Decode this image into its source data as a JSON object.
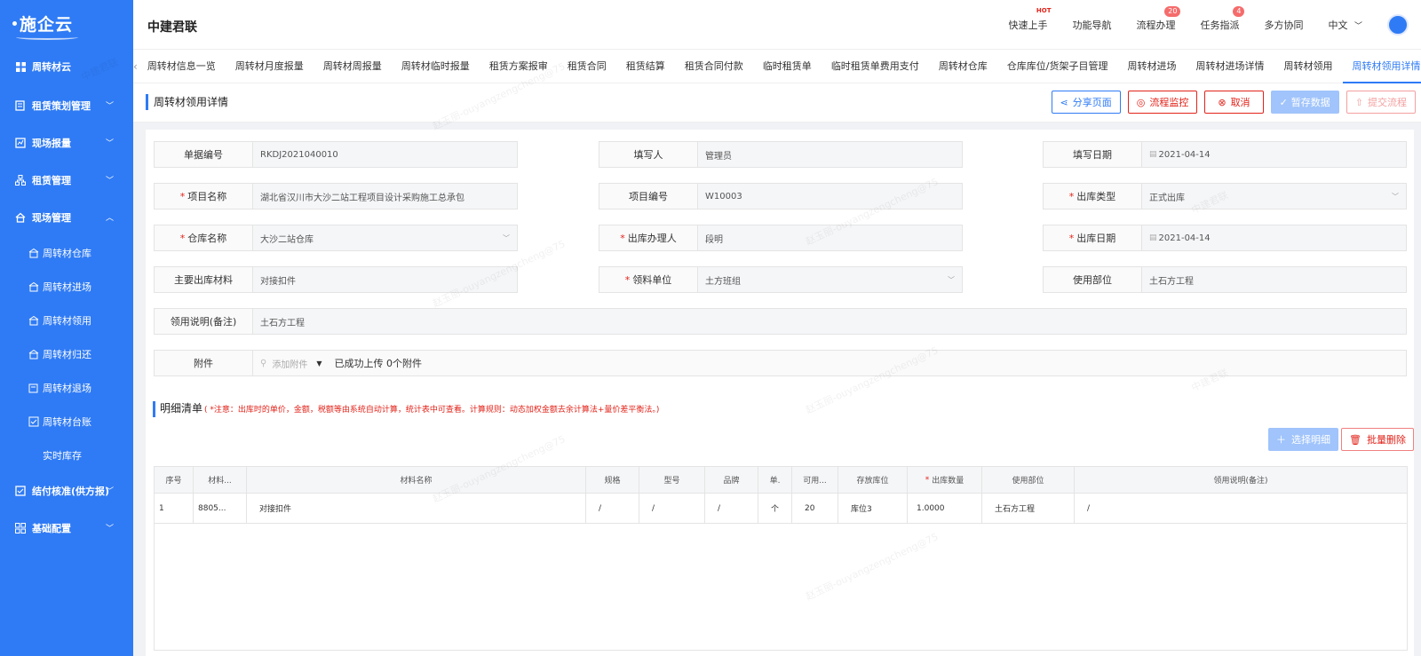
{
  "sidebar": {
    "logo": "施企云",
    "items": [
      {
        "label": "周转材云",
        "icon": "grid-icon"
      },
      {
        "label": "租赁策划管理",
        "icon": "plan-icon"
      },
      {
        "label": "现场报量",
        "icon": "report-icon"
      },
      {
        "label": "租赁管理",
        "icon": "org-icon"
      },
      {
        "label": "现场管理",
        "icon": "home-icon"
      }
    ],
    "sub_items": [
      {
        "label": "周转材仓库"
      },
      {
        "label": "周转材进场"
      },
      {
        "label": "周转材领用"
      },
      {
        "label": "周转材归还"
      },
      {
        "label": "周转材退场"
      },
      {
        "label": "周转材台账"
      },
      {
        "label": "实时库存"
      }
    ],
    "bottom_items": [
      {
        "label": "结付核准(供方报)"
      },
      {
        "label": "基础配置"
      }
    ]
  },
  "header": {
    "company": "中建君联",
    "menu": [
      {
        "label": "快速上手",
        "hot": "HOT"
      },
      {
        "label": "功能导航"
      },
      {
        "label": "流程办理",
        "badge": "20"
      },
      {
        "label": "任务指派",
        "badge": "4"
      },
      {
        "label": "多方协同"
      },
      {
        "label": "中文"
      }
    ]
  },
  "tabs": [
    "周转材信息一览",
    "周转材月度报量",
    "周转材周报量",
    "周转材临时报量",
    "租赁方案报审",
    "租赁合同",
    "租赁结算",
    "租赁合同付款",
    "临时租赁单",
    "临时租赁单费用支付",
    "周转材仓库",
    "仓库库位/货架子目管理",
    "周转材进场",
    "周转材进场详情",
    "周转材领用",
    "周转材领用详情"
  ],
  "page": {
    "title": "周转材领用详情",
    "buttons": {
      "share": "分享页面",
      "monitor": "流程监控",
      "cancel": "取消",
      "save": "暂存数据",
      "submit": "提交流程"
    }
  },
  "form": {
    "doc_no": {
      "label": "单据编号",
      "value": "RKDJ2021040010"
    },
    "filler": {
      "label": "填写人",
      "value": "管理员"
    },
    "fill_date": {
      "label": "填写日期",
      "value": "2021-04-14"
    },
    "project_name": {
      "label": "项目名称",
      "value": "湖北省汉川市大沙二站工程项目设计采购施工总承包"
    },
    "project_no": {
      "label": "项目编号",
      "value": "W10003"
    },
    "out_type": {
      "label": "出库类型",
      "value": "正式出库"
    },
    "warehouse": {
      "label": "仓库名称",
      "value": "大沙二站仓库"
    },
    "handler": {
      "label": "出库办理人",
      "value": "段明"
    },
    "out_date": {
      "label": "出库日期",
      "value": "2021-04-14"
    },
    "main_material": {
      "label": "主要出库材料",
      "value": "对接扣件"
    },
    "receiver": {
      "label": "领料单位",
      "value": "土方班组"
    },
    "department": {
      "label": "使用部位",
      "value": "土石方工程"
    },
    "remark": {
      "label": "领用说明(备注)",
      "value": "土石方工程"
    },
    "attachment": {
      "label": "附件",
      "add": "添加附件",
      "status": "已成功上传 0个附件"
    }
  },
  "detail": {
    "title": "明细清单",
    "note": "( *注意：出库时的单价，金额，税额等由系统自动计算，统计表中可查看。计算规则：动态加权金额去余计算法+量价差平衡法。)",
    "select_btn": "选择明细",
    "batch_delete_btn": "批量删除",
    "columns": [
      "序号",
      "材料...",
      "材料名称",
      "规格",
      "型号",
      "品牌",
      "单.",
      "可用...",
      "存放库位",
      "出库数量",
      "使用部位",
      "领用说明(备注)"
    ],
    "rows": [
      [
        "1",
        "8805...",
        "对接扣件",
        "/",
        "/",
        "/",
        "个",
        "20",
        "库位3",
        "1.0000",
        "土石方工程",
        "/"
      ]
    ]
  },
  "watermark": [
    "中建君联",
    "赵玉丽-ouyangzengcheng@75"
  ]
}
